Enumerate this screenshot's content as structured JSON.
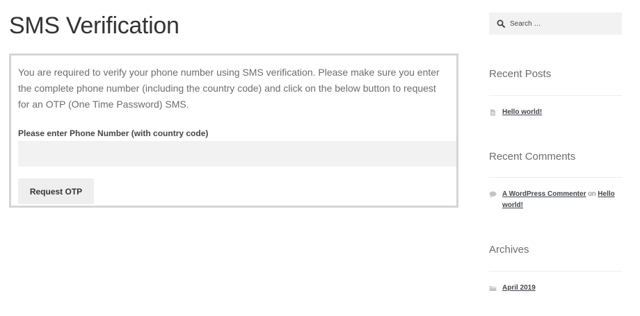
{
  "page": {
    "title": "SMS Verification"
  },
  "sms_form": {
    "intro_text": "You are required to verify your phone number using SMS verification. Please make sure you enter the complete phone number (including the country code) and click on the below button to request for an OTP (One Time Password) SMS.",
    "phone_label": "Please enter Phone Number (with country code)",
    "phone_value": "",
    "request_button": "Request OTP"
  },
  "sidebar": {
    "search": {
      "placeholder": "Search …",
      "icon": "search-icon"
    },
    "recent_posts": {
      "title": "Recent Posts",
      "items": [
        {
          "label": "Hello world!",
          "icon": "document-icon"
        }
      ]
    },
    "recent_comments": {
      "title": "Recent Comments",
      "items": [
        {
          "author": "A WordPress Commenter",
          "on": "on",
          "post": "Hello world!",
          "icon": "comment-icon"
        }
      ]
    },
    "archives": {
      "title": "Archives",
      "items": [
        {
          "label": "April 2019",
          "icon": "folder-icon"
        }
      ]
    }
  },
  "colors": {
    "text": "#6d6d6d",
    "heading": "#333333",
    "link": "#43454b",
    "box_border": "#d5d5d5",
    "input_bg": "#f2f2f2",
    "button_bg": "#eeeeee"
  }
}
